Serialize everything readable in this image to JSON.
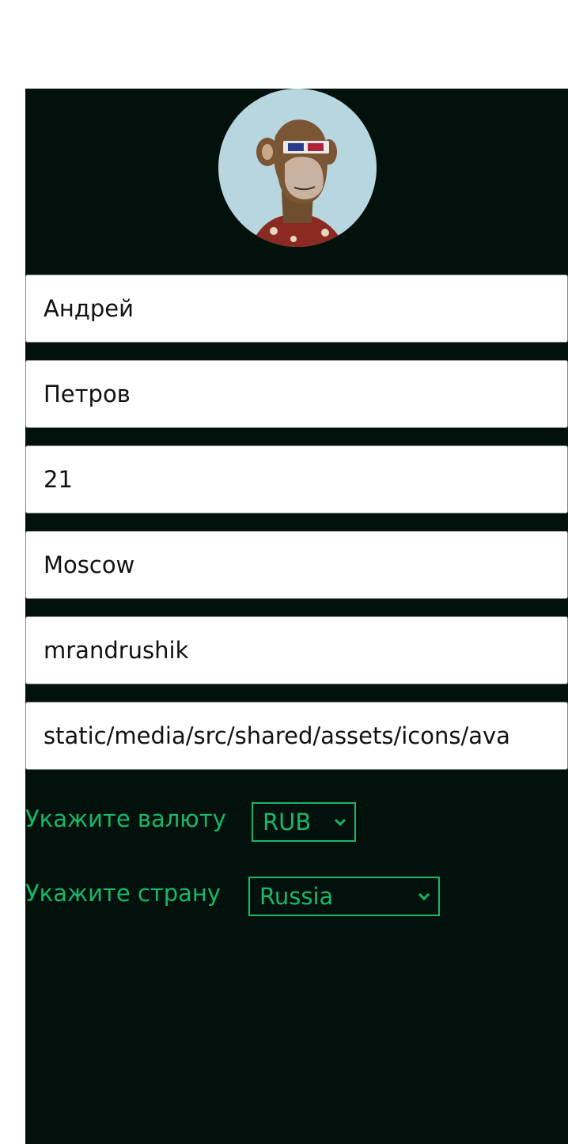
{
  "profile": {
    "avatar_icon": "ape-avatar-icon",
    "fields": [
      {
        "name": "first-name-field",
        "value": "Андрей"
      },
      {
        "name": "last-name-field",
        "value": "Петров"
      },
      {
        "name": "age-field",
        "value": "21"
      },
      {
        "name": "city-field",
        "value": "Moscow"
      },
      {
        "name": "username-field",
        "value": "mrandrushik"
      },
      {
        "name": "avatar-path-field",
        "value": "static/media/src/shared/assets/icons/ava"
      }
    ],
    "currency": {
      "label": "Укажите валюту",
      "selected": "RUB"
    },
    "country": {
      "label": "Укажите страну",
      "selected": "Russia"
    }
  },
  "colors": {
    "panel": "#02110c",
    "accent": "#17b86a",
    "avatar_bg": "#b7d6df"
  }
}
